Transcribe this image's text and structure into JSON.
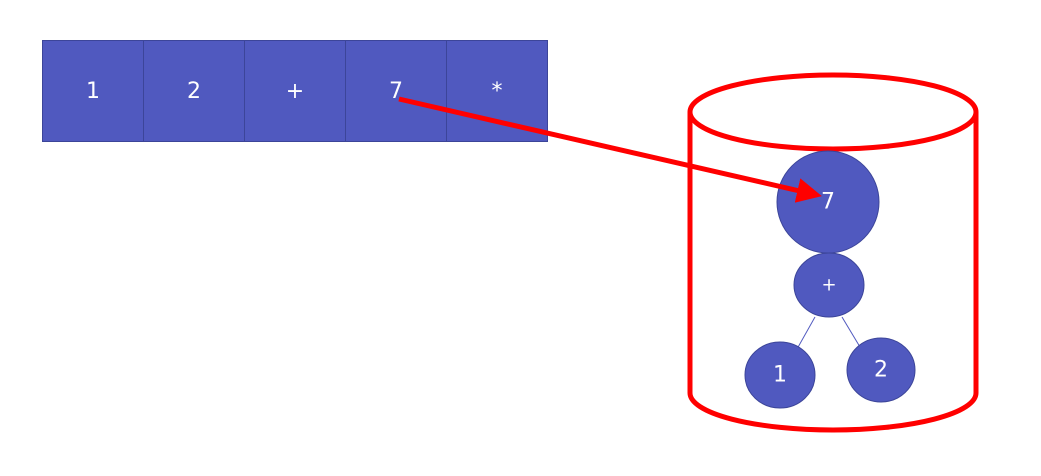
{
  "tokens": [
    "1",
    "2",
    "+",
    "7",
    "*"
  ],
  "stack": {
    "nodes": {
      "top": "7",
      "operator": "+",
      "left_child": "1",
      "right_child": "2"
    }
  },
  "colors": {
    "node_fill": "#5059bf",
    "node_stroke": "#3c4599",
    "container": "#ff0000",
    "arrow": "#ff0000",
    "edge": "#5059bf",
    "label": "#ffffff"
  }
}
